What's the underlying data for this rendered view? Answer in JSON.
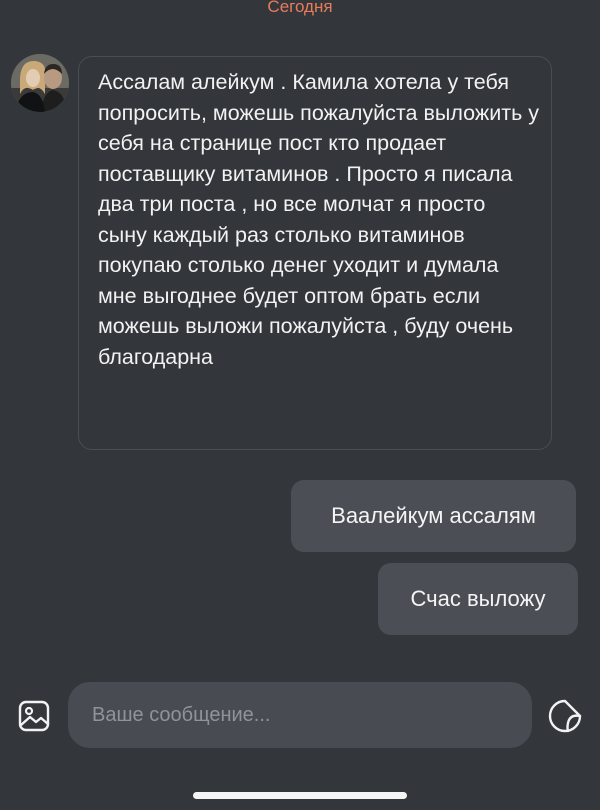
{
  "chat": {
    "date_label": "Сегодня",
    "messages": [
      {
        "direction": "incoming",
        "text": "Ассалам алейкум . Камила хотела у тебя попросить,  можешь пожалуйста выложить у себя на странице пост кто продает поставщику витаминов . Просто  я писала два три поста , но все молчат я просто сыну каждый раз столько витаминов покупаю столько денег уходит и думала мне выгоднее будет оптом брать если можешь выложи пожалуйста , буду очень благодарна"
      },
      {
        "direction": "outgoing",
        "text": "Ваалейкум ассалям"
      },
      {
        "direction": "outgoing",
        "text": "Счас выложу"
      }
    ]
  },
  "composer": {
    "placeholder": "Ваше сообщение...",
    "gallery_icon": "image-gallery-icon",
    "sticker_icon": "sticker-icon"
  },
  "colors": {
    "background": "#33373c",
    "date_label": "#e97b5a",
    "outgoing_bubble": "#4b4f55",
    "incoming_border": "#4a4e54",
    "input_background": "#484c52",
    "placeholder": "#8f949a",
    "text": "#f2f2f2"
  }
}
